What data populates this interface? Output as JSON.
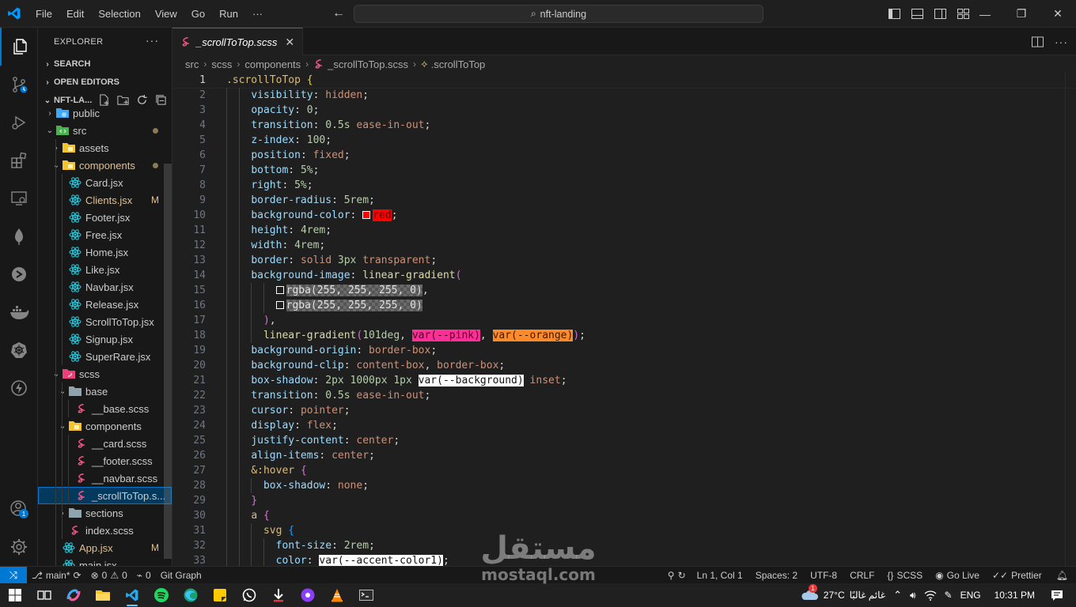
{
  "titlebar": {
    "menu": [
      "File",
      "Edit",
      "Selection",
      "View",
      "Go",
      "Run",
      "···"
    ],
    "search_text": "nft-landing"
  },
  "sidebar": {
    "title": "EXPLORER",
    "sections": {
      "search": "SEARCH",
      "open_editors": "OPEN EDITORS",
      "project": "NFT-LA..."
    },
    "tree": [
      {
        "label": "public",
        "indent": 1,
        "chev": "›",
        "icon": "folder-blue"
      },
      {
        "label": "src",
        "indent": 1,
        "chev": "⌄",
        "icon": "folder-green",
        "dot": true
      },
      {
        "label": "assets",
        "indent": 2,
        "chev": "›",
        "icon": "folder-yellow"
      },
      {
        "label": "components",
        "indent": 2,
        "chev": "⌄",
        "icon": "folder-yellow",
        "dot": true,
        "modified": true
      },
      {
        "label": "Card.jsx",
        "indent": 3,
        "icon": "react"
      },
      {
        "label": "Clients.jsx",
        "indent": 3,
        "icon": "react",
        "badge": "M",
        "modified": true
      },
      {
        "label": "Footer.jsx",
        "indent": 3,
        "icon": "react"
      },
      {
        "label": "Free.jsx",
        "indent": 3,
        "icon": "react"
      },
      {
        "label": "Home.jsx",
        "indent": 3,
        "icon": "react"
      },
      {
        "label": "Like.jsx",
        "indent": 3,
        "icon": "react"
      },
      {
        "label": "Navbar.jsx",
        "indent": 3,
        "icon": "react"
      },
      {
        "label": "Release.jsx",
        "indent": 3,
        "icon": "react"
      },
      {
        "label": "ScrollToTop.jsx",
        "indent": 3,
        "icon": "react"
      },
      {
        "label": "Signup.jsx",
        "indent": 3,
        "icon": "react"
      },
      {
        "label": "SuperRare.jsx",
        "indent": 3,
        "icon": "react"
      },
      {
        "label": "scss",
        "indent": 2,
        "chev": "⌄",
        "icon": "folder-pink"
      },
      {
        "label": "base",
        "indent": 3,
        "chev": "⌄",
        "icon": "folder-grey"
      },
      {
        "label": "__base.scss",
        "indent": 4,
        "icon": "sass"
      },
      {
        "label": "components",
        "indent": 3,
        "chev": "⌄",
        "icon": "folder-yellow"
      },
      {
        "label": "__card.scss",
        "indent": 4,
        "icon": "sass"
      },
      {
        "label": "__footer.scss",
        "indent": 4,
        "icon": "sass"
      },
      {
        "label": "__navbar.scss",
        "indent": 4,
        "icon": "sass"
      },
      {
        "label": "_scrollToTop.s...",
        "indent": 4,
        "icon": "sass",
        "selected": true
      },
      {
        "label": "sections",
        "indent": 3,
        "chev": "›",
        "icon": "folder-grey"
      },
      {
        "label": "index.scss",
        "indent": 3,
        "icon": "sass"
      },
      {
        "label": "App.jsx",
        "indent": 2,
        "icon": "react",
        "badge": "M",
        "modified": true
      },
      {
        "label": "main.jsx",
        "indent": 2,
        "icon": "react"
      }
    ]
  },
  "editor": {
    "tab_label": "_scrollToTop.scss",
    "breadcrumb": [
      "src",
      "scss",
      "components",
      "_scrollToTop.scss",
      ".scrollToTop"
    ],
    "lines": [
      [
        [
          "sel",
          ".scrollToTop"
        ],
        [
          "pun",
          " "
        ],
        [
          "brk",
          "{"
        ]
      ],
      [
        [
          "ws",
          "    "
        ],
        [
          "prop",
          "visibility"
        ],
        [
          "pun",
          ": "
        ],
        [
          "val",
          "hidden"
        ],
        [
          "pun",
          ";"
        ]
      ],
      [
        [
          "ws",
          "    "
        ],
        [
          "prop",
          "opacity"
        ],
        [
          "pun",
          ": "
        ],
        [
          "num",
          "0"
        ],
        [
          "pun",
          ";"
        ]
      ],
      [
        [
          "ws",
          "    "
        ],
        [
          "prop",
          "transition"
        ],
        [
          "pun",
          ": "
        ],
        [
          "num",
          "0.5s"
        ],
        [
          "pun",
          " "
        ],
        [
          "val",
          "ease-in-out"
        ],
        [
          "pun",
          ";"
        ]
      ],
      [
        [
          "ws",
          "    "
        ],
        [
          "prop",
          "z-index"
        ],
        [
          "pun",
          ": "
        ],
        [
          "num",
          "100"
        ],
        [
          "pun",
          ";"
        ]
      ],
      [
        [
          "ws",
          "    "
        ],
        [
          "prop",
          "position"
        ],
        [
          "pun",
          ": "
        ],
        [
          "val",
          "fixed"
        ],
        [
          "pun",
          ";"
        ]
      ],
      [
        [
          "ws",
          "    "
        ],
        [
          "prop",
          "bottom"
        ],
        [
          "pun",
          ": "
        ],
        [
          "num",
          "5%"
        ],
        [
          "pun",
          ";"
        ]
      ],
      [
        [
          "ws",
          "    "
        ],
        [
          "prop",
          "right"
        ],
        [
          "pun",
          ": "
        ],
        [
          "num",
          "5%"
        ],
        [
          "pun",
          ";"
        ]
      ],
      [
        [
          "ws",
          "    "
        ],
        [
          "prop",
          "border-radius"
        ],
        [
          "pun",
          ": "
        ],
        [
          "num",
          "5rem"
        ],
        [
          "pun",
          ";"
        ]
      ],
      [
        [
          "ws",
          "    "
        ],
        [
          "prop",
          "background-color"
        ],
        [
          "pun",
          ": "
        ],
        [
          "sw",
          "#ff0000"
        ],
        [
          "hl-red",
          "red"
        ],
        [
          "pun",
          ";"
        ]
      ],
      [
        [
          "ws",
          "    "
        ],
        [
          "prop",
          "height"
        ],
        [
          "pun",
          ": "
        ],
        [
          "num",
          "4rem"
        ],
        [
          "pun",
          ";"
        ]
      ],
      [
        [
          "ws",
          "    "
        ],
        [
          "prop",
          "width"
        ],
        [
          "pun",
          ": "
        ],
        [
          "num",
          "4rem"
        ],
        [
          "pun",
          ";"
        ]
      ],
      [
        [
          "ws",
          "    "
        ],
        [
          "prop",
          "border"
        ],
        [
          "pun",
          ": "
        ],
        [
          "val",
          "solid"
        ],
        [
          "pun",
          " "
        ],
        [
          "num",
          "3px"
        ],
        [
          "pun",
          " "
        ],
        [
          "val",
          "transparent"
        ],
        [
          "pun",
          ";"
        ]
      ],
      [
        [
          "ws",
          "    "
        ],
        [
          "prop",
          "background-image"
        ],
        [
          "pun",
          ": "
        ],
        [
          "fn",
          "linear-gradient"
        ],
        [
          "brk2",
          "("
        ]
      ],
      [
        [
          "ws",
          "        "
        ],
        [
          "sw",
          "transparent"
        ],
        [
          "hl-check",
          "rgba(255, 255, 255, 0)"
        ],
        [
          "pun",
          ","
        ]
      ],
      [
        [
          "ws",
          "        "
        ],
        [
          "sw",
          "transparent"
        ],
        [
          "hl-check",
          "rgba(255, 255, 255, 0)"
        ]
      ],
      [
        [
          "ws",
          "      "
        ],
        [
          "brk2",
          ")"
        ],
        [
          "pun",
          ","
        ]
      ],
      [
        [
          "ws",
          "      "
        ],
        [
          "fn",
          "linear-gradient"
        ],
        [
          "brk2",
          "("
        ],
        [
          "num",
          "101deg"
        ],
        [
          "pun",
          ", "
        ],
        [
          "hl-pink",
          "var(--pink)"
        ],
        [
          "pun",
          ", "
        ],
        [
          "hl-orange",
          "var(--orange)"
        ],
        [
          "brk2",
          ")"
        ],
        [
          "pun",
          ";"
        ]
      ],
      [
        [
          "ws",
          "    "
        ],
        [
          "prop",
          "background-origin"
        ],
        [
          "pun",
          ": "
        ],
        [
          "val",
          "border-box"
        ],
        [
          "pun",
          ";"
        ]
      ],
      [
        [
          "ws",
          "    "
        ],
        [
          "prop",
          "background-clip"
        ],
        [
          "pun",
          ": "
        ],
        [
          "val",
          "content-box"
        ],
        [
          "pun",
          ", "
        ],
        [
          "val",
          "border-box"
        ],
        [
          "pun",
          ";"
        ]
      ],
      [
        [
          "ws",
          "    "
        ],
        [
          "prop",
          "box-shadow"
        ],
        [
          "pun",
          ": "
        ],
        [
          "num",
          "2px 1000px 1px"
        ],
        [
          "pun",
          " "
        ],
        [
          "hl-white",
          "var(--background)"
        ],
        [
          "pun",
          " "
        ],
        [
          "val",
          "inset"
        ],
        [
          "pun",
          ";"
        ]
      ],
      [
        [
          "ws",
          "    "
        ],
        [
          "prop",
          "transition"
        ],
        [
          "pun",
          ": "
        ],
        [
          "num",
          "0.5s"
        ],
        [
          "pun",
          " "
        ],
        [
          "val",
          "ease-in-out"
        ],
        [
          "pun",
          ";"
        ]
      ],
      [
        [
          "ws",
          "    "
        ],
        [
          "prop",
          "cursor"
        ],
        [
          "pun",
          ": "
        ],
        [
          "val",
          "pointer"
        ],
        [
          "pun",
          ";"
        ]
      ],
      [
        [
          "ws",
          "    "
        ],
        [
          "prop",
          "display"
        ],
        [
          "pun",
          ": "
        ],
        [
          "val",
          "flex"
        ],
        [
          "pun",
          ";"
        ]
      ],
      [
        [
          "ws",
          "    "
        ],
        [
          "prop",
          "justify-content"
        ],
        [
          "pun",
          ": "
        ],
        [
          "val",
          "center"
        ],
        [
          "pun",
          ";"
        ]
      ],
      [
        [
          "ws",
          "    "
        ],
        [
          "prop",
          "align-items"
        ],
        [
          "pun",
          ": "
        ],
        [
          "val",
          "center"
        ],
        [
          "pun",
          ";"
        ]
      ],
      [
        [
          "ws",
          "    "
        ],
        [
          "sel",
          "&:hover"
        ],
        [
          "pun",
          " "
        ],
        [
          "brk2",
          "{"
        ]
      ],
      [
        [
          "ws",
          "      "
        ],
        [
          "prop",
          "box-shadow"
        ],
        [
          "pun",
          ": "
        ],
        [
          "val",
          "none"
        ],
        [
          "pun",
          ";"
        ]
      ],
      [
        [
          "ws",
          "    "
        ],
        [
          "brk2",
          "}"
        ]
      ],
      [
        [
          "ws",
          "    "
        ],
        [
          "sel",
          "a"
        ],
        [
          "pun",
          " "
        ],
        [
          "brk2",
          "{"
        ]
      ],
      [
        [
          "ws",
          "      "
        ],
        [
          "sel",
          "svg"
        ],
        [
          "pun",
          " "
        ],
        [
          "brk3",
          "{"
        ]
      ],
      [
        [
          "ws",
          "        "
        ],
        [
          "prop",
          "font-size"
        ],
        [
          "pun",
          ": "
        ],
        [
          "num",
          "2rem"
        ],
        [
          "pun",
          ";"
        ]
      ],
      [
        [
          "ws",
          "        "
        ],
        [
          "prop",
          "color"
        ],
        [
          "pun",
          ": "
        ],
        [
          "hl-white",
          "var(--accent-color1)"
        ],
        [
          "pun",
          ";"
        ]
      ]
    ]
  },
  "statusbar": {
    "branch": "main*",
    "errors": "0",
    "warnings": "0",
    "ports": "0",
    "git_graph": "Git Graph",
    "position": "Ln 1, Col 1",
    "spaces": "Spaces: 2",
    "encoding": "UTF-8",
    "eol": "CRLF",
    "language": "SCSS",
    "golive": "Go Live",
    "prettier": "Prettier"
  },
  "taskbar": {
    "temperature": "27°C",
    "weather_text": "غائم غالبًا",
    "language": "ENG",
    "time": "10:31 PM",
    "weather_badge": "1"
  },
  "activitybar": {
    "account_badge": "1"
  },
  "watermark": {
    "arabic": "مستقل",
    "latin": "mostaql.com"
  }
}
